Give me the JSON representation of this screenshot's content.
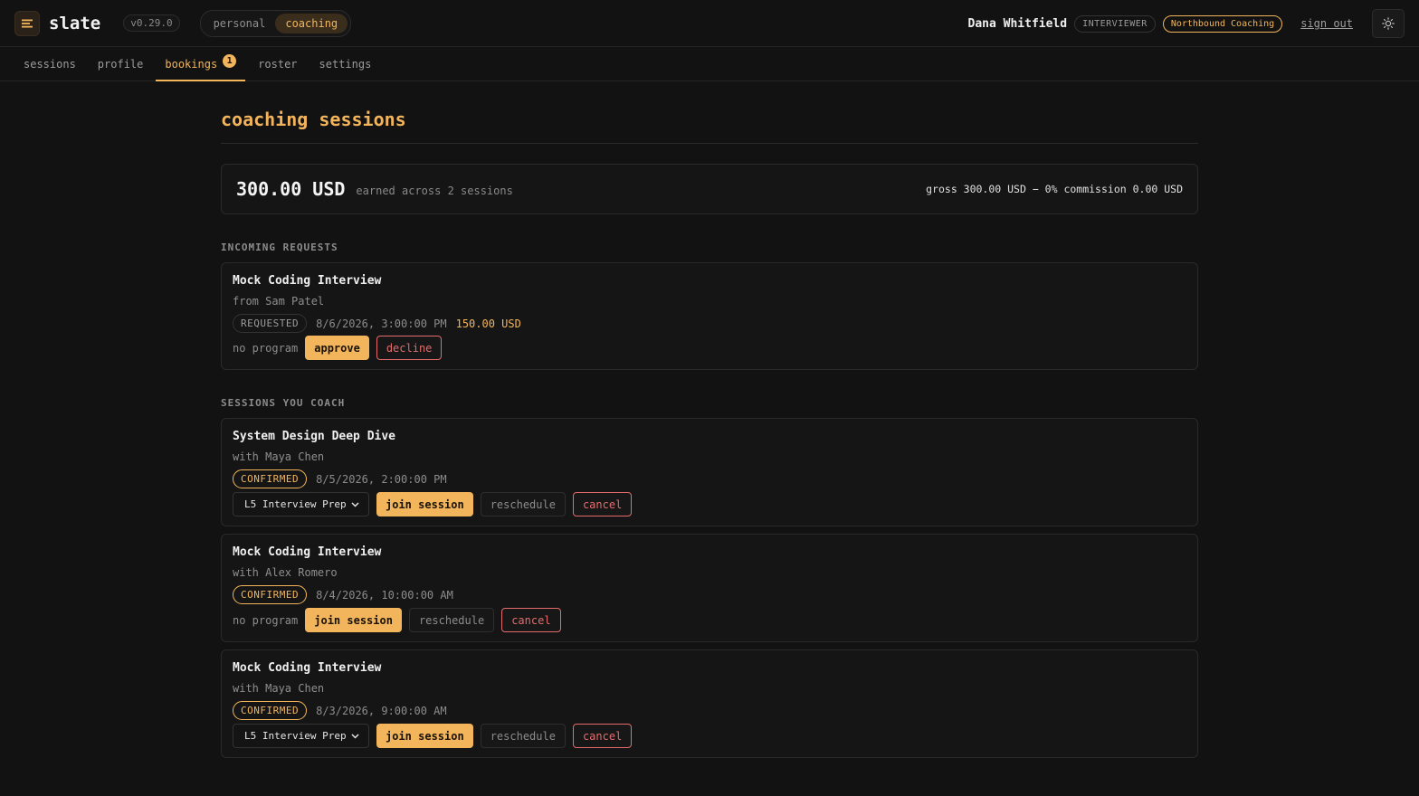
{
  "app": {
    "name": "slate",
    "version": "v0.29.0",
    "modes": [
      "personal",
      "coaching"
    ],
    "active_mode": "coaching"
  },
  "user": {
    "name": "Dana Whitfield",
    "role": "INTERVIEWER",
    "org": "Northbound Coaching",
    "signout_label": "sign out"
  },
  "icons": {
    "logo": "menu-lines-icon",
    "theme": "sun-icon",
    "dropdown": "chevron-down-icon"
  },
  "colors": {
    "accent": "#f3b55c",
    "danger": "#e36b6b",
    "background": "#121212"
  },
  "tabs": [
    {
      "label": "sessions"
    },
    {
      "label": "profile"
    },
    {
      "label": "bookings",
      "badge": "1"
    },
    {
      "label": "roster"
    },
    {
      "label": "settings"
    }
  ],
  "active_tab": "bookings",
  "page": {
    "title": "coaching sessions"
  },
  "earnings": {
    "amount": "300.00 USD",
    "subtitle": "earned across 2 sessions",
    "breakdown": "gross 300.00 USD − 0% commission 0.00 USD"
  },
  "sections": {
    "incoming": "INCOMING REQUESTS",
    "coaching": "SESSIONS YOU COACH"
  },
  "requests": [
    {
      "title": "Mock Coding Interview",
      "from": "from Sam Patel",
      "status": "REQUESTED",
      "date": "8/6/2026, 3:00:00 PM",
      "price": "150.00 USD",
      "program": "no program",
      "approve_label": "approve",
      "decline_label": "decline"
    }
  ],
  "sessions": [
    {
      "title": "System Design Deep Dive",
      "with": "with Maya Chen",
      "status": "CONFIRMED",
      "date": "8/5/2026, 2:00:00 PM",
      "program": "L5 Interview Prep",
      "join_label": "join session",
      "reschedule_label": "reschedule",
      "cancel_label": "cancel"
    },
    {
      "title": "Mock Coding Interview",
      "with": "with Alex Romero",
      "status": "CONFIRMED",
      "date": "8/4/2026, 10:00:00 AM",
      "program": "no program",
      "join_label": "join session",
      "reschedule_label": "reschedule",
      "cancel_label": "cancel"
    },
    {
      "title": "Mock Coding Interview",
      "with": "with Maya Chen",
      "status": "CONFIRMED",
      "date": "8/3/2026, 9:00:00 AM",
      "program": "L5 Interview Prep",
      "join_label": "join session",
      "reschedule_label": "reschedule",
      "cancel_label": "cancel"
    }
  ]
}
